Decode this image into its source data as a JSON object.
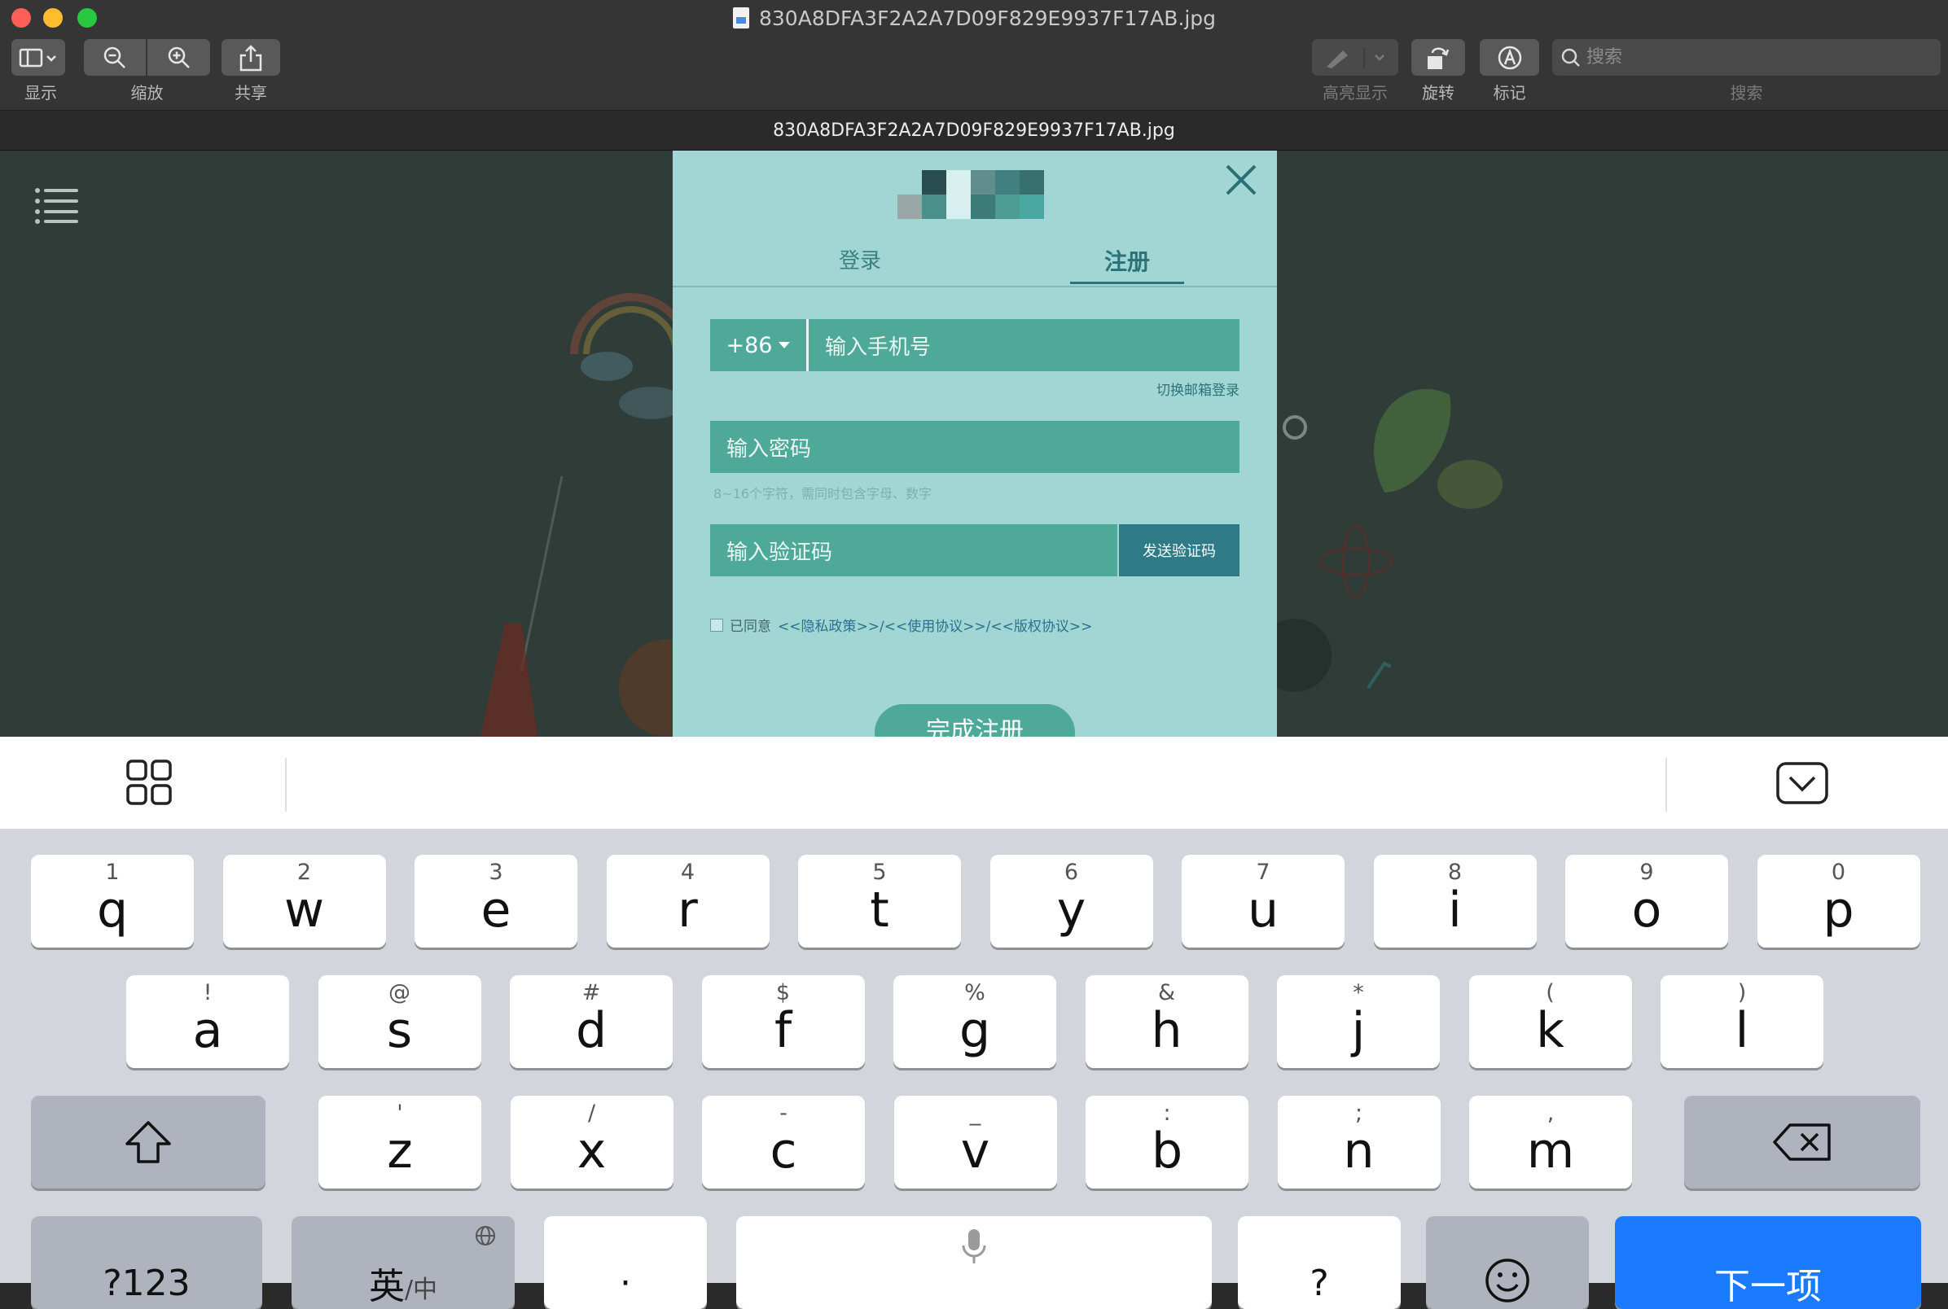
{
  "window": {
    "title": "830A8DFA3F2A2A7D09F829E9937F17AB.jpg",
    "tab_title": "830A8DFA3F2A2A7D09F829E9937F17AB.jpg"
  },
  "toolbar": {
    "display_label": "显示",
    "zoom_label": "缩放",
    "share_label": "共享",
    "highlight_label": "高亮显示",
    "rotate_label": "旋转",
    "markup_label": "标记",
    "search_label": "搜索",
    "search_placeholder": "搜索"
  },
  "modal": {
    "tab_login": "登录",
    "tab_register": "注册",
    "country_code": "+86",
    "phone_placeholder": "输入手机号",
    "switch_email": "切换邮箱登录",
    "password_placeholder": "输入密码",
    "password_hint": "8~16个字符，需同时包含字母、数字",
    "code_placeholder": "输入验证码",
    "send_code": "发送验证码",
    "agree_text": "已同意",
    "agree_links": "<<隐私政策>>/<<使用协议>>/<<版权协议>>",
    "finish_button": "完成注册"
  },
  "keyboard": {
    "row1": [
      {
        "alt": "1",
        "main": "q"
      },
      {
        "alt": "2",
        "main": "w"
      },
      {
        "alt": "3",
        "main": "e"
      },
      {
        "alt": "4",
        "main": "r"
      },
      {
        "alt": "5",
        "main": "t"
      },
      {
        "alt": "6",
        "main": "y"
      },
      {
        "alt": "7",
        "main": "u"
      },
      {
        "alt": "8",
        "main": "i"
      },
      {
        "alt": "9",
        "main": "o"
      },
      {
        "alt": "0",
        "main": "p"
      }
    ],
    "row2": [
      {
        "alt": "!",
        "main": "a"
      },
      {
        "alt": "@",
        "main": "s"
      },
      {
        "alt": "#",
        "main": "d"
      },
      {
        "alt": "$",
        "main": "f"
      },
      {
        "alt": "%",
        "main": "g"
      },
      {
        "alt": "&",
        "main": "h"
      },
      {
        "alt": "*",
        "main": "j"
      },
      {
        "alt": "(",
        "main": "k"
      },
      {
        "alt": ")",
        "main": "l"
      }
    ],
    "row3": [
      {
        "alt": "'",
        "main": "z"
      },
      {
        "alt": "/",
        "main": "x"
      },
      {
        "alt": "-",
        "main": "c"
      },
      {
        "alt": "_",
        "main": "v"
      },
      {
        "alt": ":",
        "main": "b"
      },
      {
        "alt": ";",
        "main": "n"
      },
      {
        "alt": ",",
        "main": "m"
      }
    ],
    "numbers_key": "?123",
    "lang_key_main": "英",
    "lang_key_sub": "/中",
    "period_key": "·",
    "question_key": "?",
    "next_key": "下一项"
  }
}
